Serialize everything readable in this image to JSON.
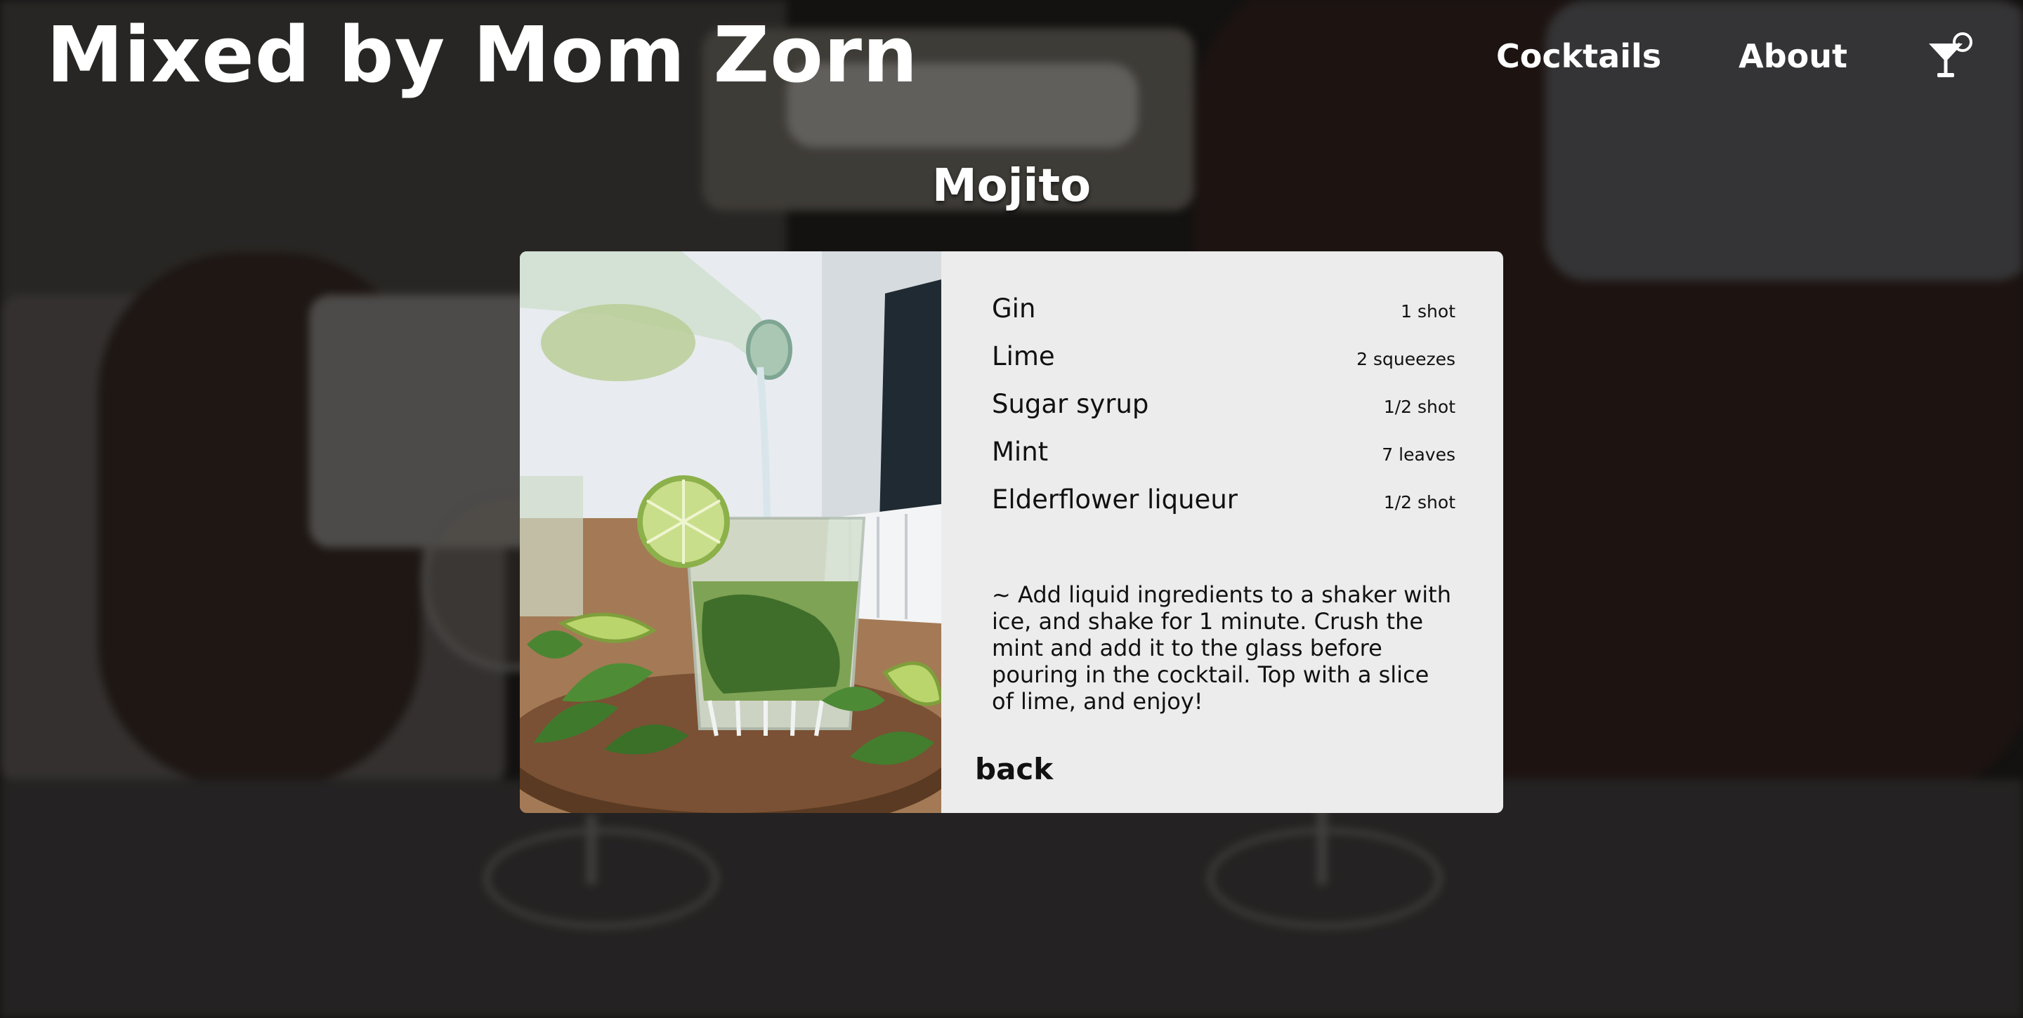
{
  "header": {
    "site_title": "Mixed by Mom Zorn",
    "nav": {
      "cocktails_label": "Cocktails",
      "about_label": "About",
      "icon": "cocktail-glass-icon"
    }
  },
  "drink": {
    "title": "Mojito",
    "image_alt": "mojito-photo",
    "ingredients": [
      {
        "name": "Gin",
        "amount": "1 shot"
      },
      {
        "name": "Lime",
        "amount": "2 squeezes"
      },
      {
        "name": "Sugar syrup",
        "amount": "1/2 shot"
      },
      {
        "name": "Mint",
        "amount": "7 leaves"
      },
      {
        "name": "Elderflower liqueur",
        "amount": "1/2 shot"
      }
    ],
    "instructions": "~ Add liquid ingredients to a shaker with ice, and shake for 1 minute. Crush the mint and add it to the glass before pouring in the cocktail. Top with a slice of lime, and enjoy!",
    "back_label": "back"
  },
  "colors": {
    "text_light": "#ffffff",
    "card_background": "#ececec",
    "text_dark": "#111111"
  }
}
